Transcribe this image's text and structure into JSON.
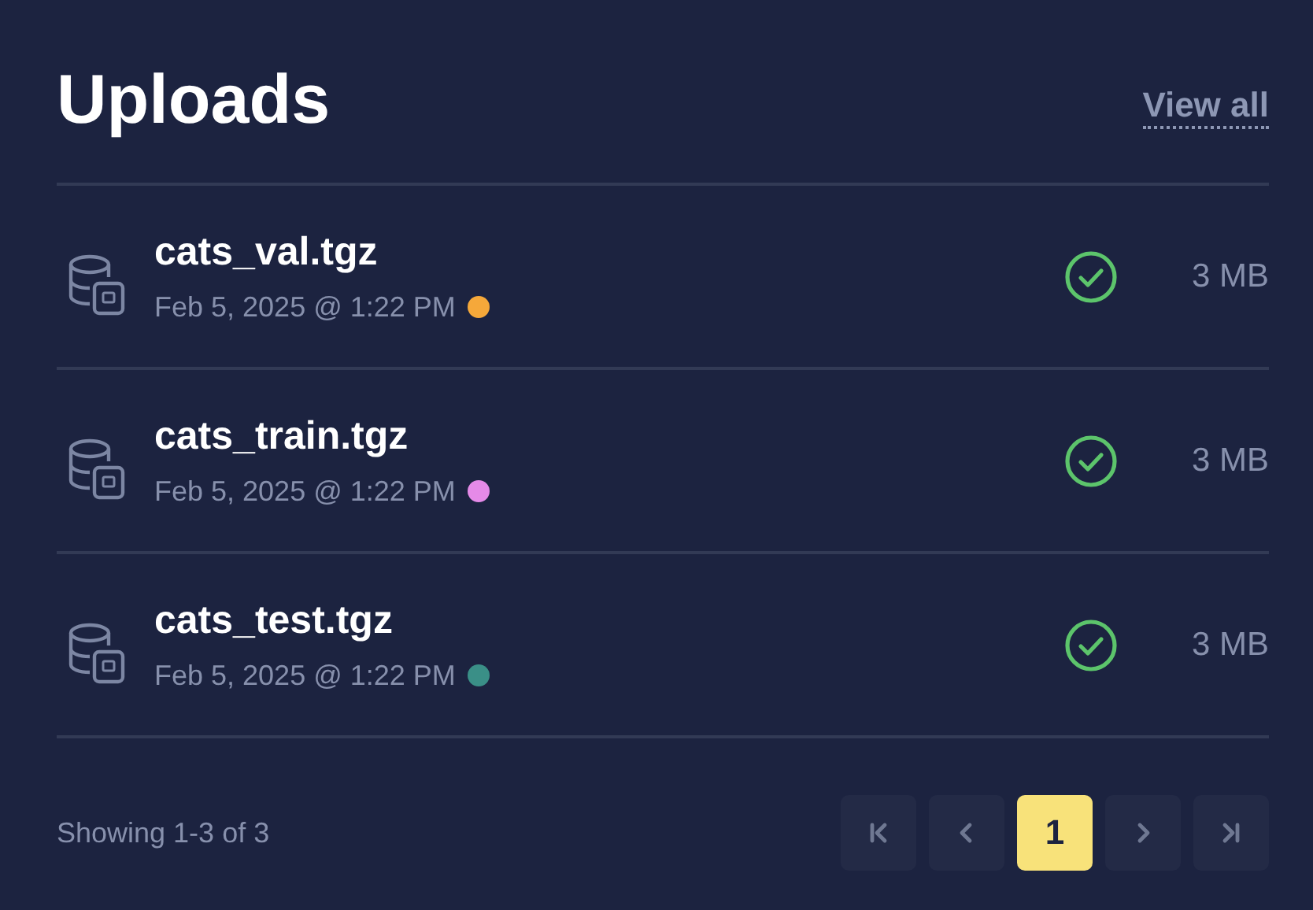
{
  "header": {
    "title": "Uploads",
    "link": "View all"
  },
  "uploads": [
    {
      "name": "cats_val.tgz",
      "date": "Feb 5, 2025 @ 1:22 PM",
      "color": "#f5a83a",
      "complete": true,
      "size": "3 MB"
    },
    {
      "name": "cats_train.tgz",
      "date": "Feb 5, 2025 @ 1:22 PM",
      "color": "#e58ae8",
      "complete": true,
      "size": "3 MB"
    },
    {
      "name": "cats_test.tgz",
      "date": "Feb 5, 2025 @ 1:22 PM",
      "color": "#3a8f87",
      "complete": true,
      "size": "3 MB"
    }
  ],
  "footer": {
    "summary": "Showing 1-3 of 3",
    "nav": [
      {
        "kind": "first",
        "disabled": true
      },
      {
        "kind": "prev",
        "disabled": true
      },
      {
        "kind": "page",
        "label": "1",
        "selected": true
      },
      {
        "kind": "next",
        "disabled": true
      },
      {
        "kind": "last",
        "disabled": true
      }
    ]
  }
}
